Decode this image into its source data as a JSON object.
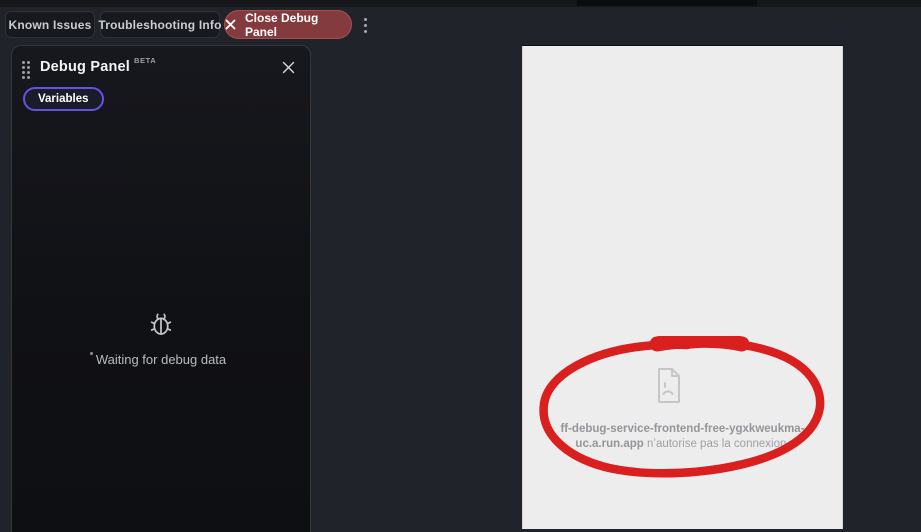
{
  "top_bar": {
    "known_issues_label": "Known Issues",
    "troubleshooting_label": "Troubleshooting Info",
    "close_debug_label": "Close Debug Panel"
  },
  "debug_panel": {
    "title": "Debug Panel",
    "beta_tag": "BETA",
    "variables_tab_label": "Variables",
    "empty_state_message": "Waiting for debug data"
  },
  "preview": {
    "error_domain_line1": "ff-debug-service-frontend-free-ygxkweukma-",
    "error_domain_line2": "uc.a.run.app",
    "error_message_rest": " n’autorise pas la connexion."
  },
  "colors": {
    "background": "#20242a",
    "panel_background": "#121318",
    "accent_purple": "#6253e6",
    "danger_button": "#833b3e",
    "annotation_red": "#da1f1f",
    "preview_background": "#ededee"
  },
  "icons": {
    "close": "x",
    "overflow": "vertical-dots",
    "drag": "dot-grid",
    "bug": "bug-outline",
    "sad_file": "sad-file-page"
  }
}
